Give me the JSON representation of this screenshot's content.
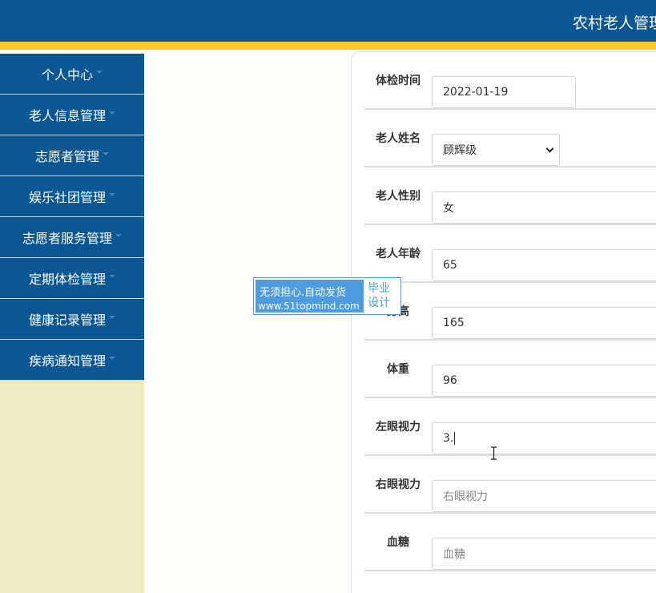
{
  "header": {
    "title": "农村老人管理"
  },
  "sidebar": {
    "items": [
      {
        "label": "个人中心"
      },
      {
        "label": "老人信息管理"
      },
      {
        "label": "志愿者管理"
      },
      {
        "label": "娱乐社团管理"
      },
      {
        "label": "志愿者服务管理"
      },
      {
        "label": "定期体检管理"
      },
      {
        "label": "健康记录管理"
      },
      {
        "label": "疾病通知管理"
      }
    ]
  },
  "form": {
    "exam_time": {
      "label": "体检时间",
      "value": "2022-01-19"
    },
    "elder_name": {
      "label": "老人姓名",
      "value": "顾辉级"
    },
    "elder_gender": {
      "label": "老人性别",
      "value": "女"
    },
    "elder_age": {
      "label": "老人年龄",
      "value": "65"
    },
    "height": {
      "label": "身高",
      "value": "165"
    },
    "weight": {
      "label": "体重",
      "value": "96"
    },
    "left_vision": {
      "label": "左眼视力",
      "value": "3."
    },
    "right_vision": {
      "label": "右眼视力",
      "placeholder": "右眼视力"
    },
    "blood_sugar": {
      "label": "血糖",
      "placeholder": "血糖"
    }
  },
  "watermark": {
    "line1": "无须担心.自动发货",
    "line2": "www.51topmind.com",
    "badge": "毕业设计"
  },
  "colors": {
    "header_bg": "#0a5794",
    "stripe": "#fac935",
    "sidebar_bg": "#efeac2",
    "watermark_bg": "#4d9ce0"
  }
}
